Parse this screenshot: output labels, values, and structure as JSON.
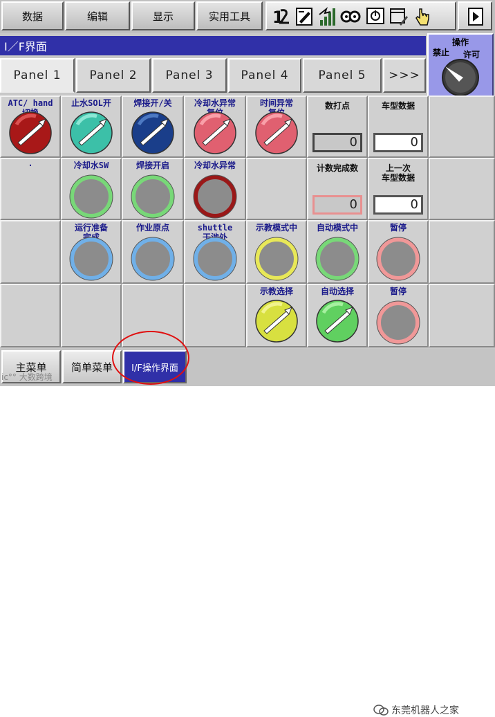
{
  "menu": {
    "items": [
      "数据",
      "编辑",
      "显示",
      "实用工具"
    ]
  },
  "toolbar": {
    "icons": [
      "one-two-icon",
      "edit-note-icon",
      "signal-bars-icon",
      "cog-link-icon",
      "io-monitor-icon",
      "window-edit-icon",
      "hand-cursor-icon"
    ],
    "play_icon": "play-icon"
  },
  "title": "I／F界面",
  "operation": {
    "title": "操作",
    "left_label": "禁止",
    "right_label": "许可"
  },
  "tabs": [
    {
      "label": "Panel 1",
      "active": true
    },
    {
      "label": "Panel 2",
      "active": false
    },
    {
      "label": "Panel 3",
      "active": false
    },
    {
      "label": "Panel 4",
      "active": false
    },
    {
      "label": "Panel 5",
      "active": false
    },
    {
      "label": ">>>",
      "active": false
    }
  ],
  "grid": {
    "rows": [
      [
        {
          "label": "ATC/ hand\n切换",
          "type": "switch",
          "color": "#a81818",
          "light": "#e86060"
        },
        {
          "label": "止水SOL开",
          "type": "switch",
          "color": "#3cc0a8",
          "light": "#a0f0e0"
        },
        {
          "label": "焊接开/关",
          "type": "switch",
          "color": "#1a3e8a",
          "light": "#5a88d0"
        },
        {
          "label": "冷却水异常\n复位",
          "type": "switch",
          "color": "#e06070",
          "light": "#ffb0b8"
        },
        {
          "label": "时间异常\n复位",
          "type": "switch",
          "color": "#e06070",
          "light": "#ffb0b8"
        },
        {
          "label": "数打点",
          "type": "number",
          "value": "0",
          "box": "gray"
        },
        {
          "label": "车型数据",
          "type": "number",
          "value": "0",
          "box": "white"
        },
        {
          "label": "",
          "type": "empty"
        }
      ],
      [
        {
          "label": "·",
          "type": "empty"
        },
        {
          "label": "冷却水SW",
          "type": "lamp",
          "ring": "#78d878"
        },
        {
          "label": "焊接开启",
          "type": "lamp",
          "ring": "#78d878"
        },
        {
          "label": "冷却水异常",
          "type": "lamp",
          "ring": "#9a1818"
        },
        {
          "label": "",
          "type": "empty"
        },
        {
          "label": "计数完成数",
          "type": "number",
          "value": "0",
          "box": "pink"
        },
        {
          "label": "上一次\n车型数据",
          "type": "number",
          "value": "0",
          "box": "white"
        },
        {
          "label": "",
          "type": "empty"
        }
      ],
      [
        {
          "label": "",
          "type": "empty"
        },
        {
          "label": "运行准备\n完成",
          "type": "lamp",
          "ring": "#70b0e8"
        },
        {
          "label": "作业原点",
          "type": "lamp",
          "ring": "#70b0e8"
        },
        {
          "label": "shuttle\n干涉外",
          "type": "lamp",
          "ring": "#70b0e8"
        },
        {
          "label": "示教模式中",
          "type": "lamp",
          "ring": "#e8e858"
        },
        {
          "label": "自动模式中",
          "type": "lamp",
          "ring": "#78d878"
        },
        {
          "label": "暂停",
          "type": "lamp",
          "ring": "#f09898"
        },
        {
          "label": "",
          "type": "empty"
        }
      ],
      [
        {
          "label": "",
          "type": "empty"
        },
        {
          "label": "",
          "type": "empty"
        },
        {
          "label": "",
          "type": "empty"
        },
        {
          "label": "",
          "type": "empty"
        },
        {
          "label": "示教选择",
          "type": "switch",
          "color": "#d8e040",
          "light": "#f8f8a0"
        },
        {
          "label": "自动选择",
          "type": "switch",
          "color": "#60d060",
          "light": "#b8f8b0"
        },
        {
          "label": "暂停",
          "type": "lamp",
          "ring": "#f09898"
        },
        {
          "label": "",
          "type": "empty"
        }
      ]
    ]
  },
  "bottom": {
    "items": [
      "主菜单",
      "简单菜单",
      "I/F操作界面"
    ],
    "selected": 2,
    "watermark": "东莞机器人之家",
    "watermark_left": "ic°° 大数跨境"
  },
  "colors": {
    "title_bar": "#3030a8",
    "op_box": "#9898e8",
    "highlight_circle": "#e01010"
  }
}
